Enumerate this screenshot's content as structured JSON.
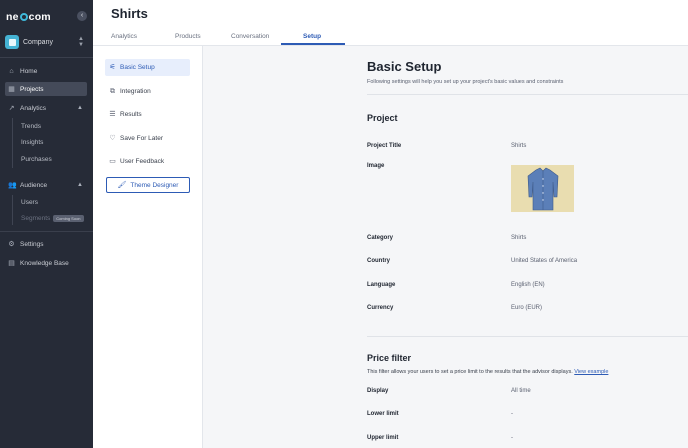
{
  "brand": {
    "logo_prefix": "ne",
    "logo_suffix": "com",
    "accent": "#3fb8d9"
  },
  "sidebar": {
    "collapse_icon": "chevron-left-icon",
    "company": "Company",
    "nav": [
      {
        "label": "Home",
        "icon": "home-icon"
      },
      {
        "label": "Projects",
        "icon": "grid-icon",
        "active": true
      },
      {
        "label": "Analytics",
        "icon": "chart-icon",
        "expanded": true
      },
      {
        "label": "Audience",
        "icon": "users-icon",
        "expanded": true
      },
      {
        "label": "Settings",
        "icon": "gear-icon"
      },
      {
        "label": "Knowledge Base",
        "icon": "book-icon"
      }
    ],
    "analytics_sub": [
      "Trends",
      "Insights",
      "Purchases"
    ],
    "audience_sub": [
      "Users",
      "Segments"
    ],
    "segments_badge": "Coming Soon"
  },
  "header": {
    "title": "Shirts",
    "tabs": [
      "Analytics",
      "Products",
      "Conversation",
      "Setup"
    ],
    "active_tab": "Setup"
  },
  "setup_nav": {
    "items": [
      {
        "label": "Basic Setup",
        "icon": "sliders-icon",
        "active": true
      },
      {
        "label": "Integration",
        "icon": "code-icon"
      },
      {
        "label": "Results",
        "icon": "list-icon"
      },
      {
        "label": "Save For Later",
        "icon": "heart-icon"
      },
      {
        "label": "User Feedback",
        "icon": "message-icon"
      }
    ],
    "theme_button": "Theme Designer"
  },
  "basic_setup": {
    "title": "Basic Setup",
    "description": "Following settings will help you set up your project's basic values and constraints",
    "project": {
      "heading": "Project",
      "rows": [
        {
          "label": "Project Title",
          "value": "Shirts"
        },
        {
          "label": "Image",
          "value": ""
        },
        {
          "label": "Category",
          "value": "Shirts"
        },
        {
          "label": "Country",
          "value": "United States of America"
        },
        {
          "label": "Language",
          "value": "English (EN)"
        },
        {
          "label": "Currency",
          "value": "Euro (EUR)"
        }
      ]
    },
    "price_filter": {
      "heading": "Price filter",
      "description": "This filter allows your users to set a price limit to the results that the advisor displays.",
      "link": "View example",
      "rows": [
        {
          "label": "Display",
          "value": "All time"
        },
        {
          "label": "Lower limit",
          "value": "-"
        },
        {
          "label": "Upper limit",
          "value": "-"
        }
      ]
    }
  }
}
